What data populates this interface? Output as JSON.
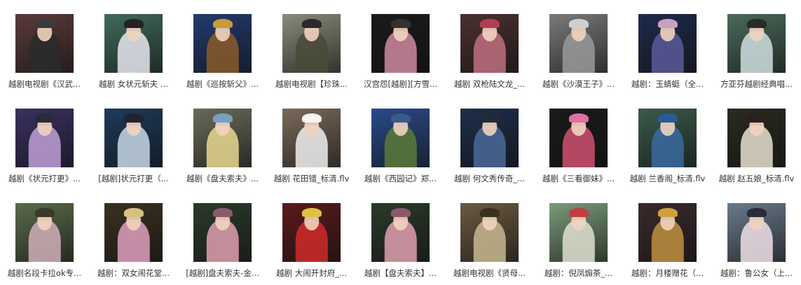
{
  "files": [
    {
      "caption": "越剧电视剧《汉武...",
      "bg": "#5a3a3a",
      "fig": "#2a2a2a",
      "hat": "#3b3b3b"
    },
    {
      "caption": "越剧 女状元斩夫 ...",
      "bg": "#3f6b5a",
      "fig": "#e8e8f0",
      "hat": "#222222"
    },
    {
      "caption": "越剧《巡按斩父》...",
      "bg": "#223a6e",
      "fig": "#8a5a2a",
      "hat": "#c89a3a"
    },
    {
      "caption": "越剧电视剧【珍珠...",
      "bg": "#8a8a7a",
      "fig": "#4a4a3a",
      "hat": "#2a2a2a"
    },
    {
      "caption": "汉宫怨[越剧][方雪...",
      "bg": "#1a1a1a",
      "fig": "#d08aa0",
      "hat": "#333333"
    },
    {
      "caption": "越剧 双枪陆文龙_...",
      "bg": "#4a3030",
      "fig": "#c07080",
      "hat": "#b04050"
    },
    {
      "caption": "越剧《沙漠王子》...",
      "bg": "#7a7a7a",
      "fig": "#9a9a9a",
      "hat": "#cfcfcf"
    },
    {
      "caption": "越剧：玉蜻蜓（全...",
      "bg": "#1e2a4a",
      "fig": "#5a5a9a",
      "hat": "#c8a0c0"
    },
    {
      "caption": "方亚芬越剧经典唱...",
      "bg": "#4a6a5a",
      "fig": "#cfe0e0",
      "hat": "#2a2a2a"
    },
    {
      "caption": "越剧《状元打更》...",
      "bg": "#3a3060",
      "fig": "#c0a0d8",
      "hat": "#2a2a3a"
    },
    {
      "caption": "[越剧]状元打更（...",
      "bg": "#1e3a5a",
      "fig": "#c8d8e8",
      "hat": "#222233"
    },
    {
      "caption": "越剧《盘夫索夫》...",
      "bg": "#6a6a5a",
      "fig": "#e8d890",
      "hat": "#7aa0c0"
    },
    {
      "caption": "越剧 花田错_标清.flv",
      "bg": "#7a6a5a",
      "fig": "#f0f0f0",
      "hat": "#f5f5f5"
    },
    {
      "caption": "越剧《西园记》郑...",
      "bg": "#2a4a8a",
      "fig": "#5a7a3a",
      "hat": "#3a5a8a"
    },
    {
      "caption": "越剧 何文秀传奇_...",
      "bg": "#1e2e4a",
      "fig": "#4a6a9a",
      "hat": "#222a3a"
    },
    {
      "caption": "越剧《三看御妹》...",
      "bg": "#1a1a1a",
      "fig": "#d05070",
      "hat": "#e070a0"
    },
    {
      "caption": "越剧 兰香阁_标清.flv",
      "bg": "#3a5a4a",
      "fig": "#3a6aa0",
      "hat": "#2a5a9a"
    },
    {
      "caption": "越剧 赵五娘_标清.flv",
      "bg": "#2a2a20",
      "fig": "#e8e0d0",
      "hat": "#2a2020"
    },
    {
      "caption": "越剧名段卡拉ok专...",
      "bg": "#5a6a4a",
      "fig": "#d0b0b8",
      "hat": "#3a3a2a"
    },
    {
      "caption": "越剧：双女闹花堂...",
      "bg": "#3a3020",
      "fig": "#e0a0c0",
      "hat": "#d8c080"
    },
    {
      "caption": "[越剧]盘夫索夫-金...",
      "bg": "#2a3a2a",
      "fig": "#e0a0b0",
      "hat": "#8a5a6a"
    },
    {
      "caption": "越剧 大闹开封府_...",
      "bg": "#5a1a1a",
      "fig": "#d02a2a",
      "hat": "#e0c040"
    },
    {
      "caption": "越剧【盘夫索夫】...",
      "bg": "#2a3a2a",
      "fig": "#e0a0b0",
      "hat": "#8a5a6a"
    },
    {
      "caption": "越剧电视剧《贤母...",
      "bg": "#6a5a40",
      "fig": "#c8b890",
      "hat": "#3a3020"
    },
    {
      "caption": "越剧：倪凤煽茶_...",
      "bg": "#7a9a7a",
      "fig": "#e0e0d0",
      "hat": "#c04040"
    },
    {
      "caption": "越剧：月楼赠花（...",
      "bg": "#3a2a2a",
      "fig": "#c09040",
      "hat": "#d0a040"
    },
    {
      "caption": "越剧：鲁公女（上...",
      "bg": "#6a7a8a",
      "fig": "#f0e0e8",
      "hat": "#2a2a3a"
    }
  ]
}
